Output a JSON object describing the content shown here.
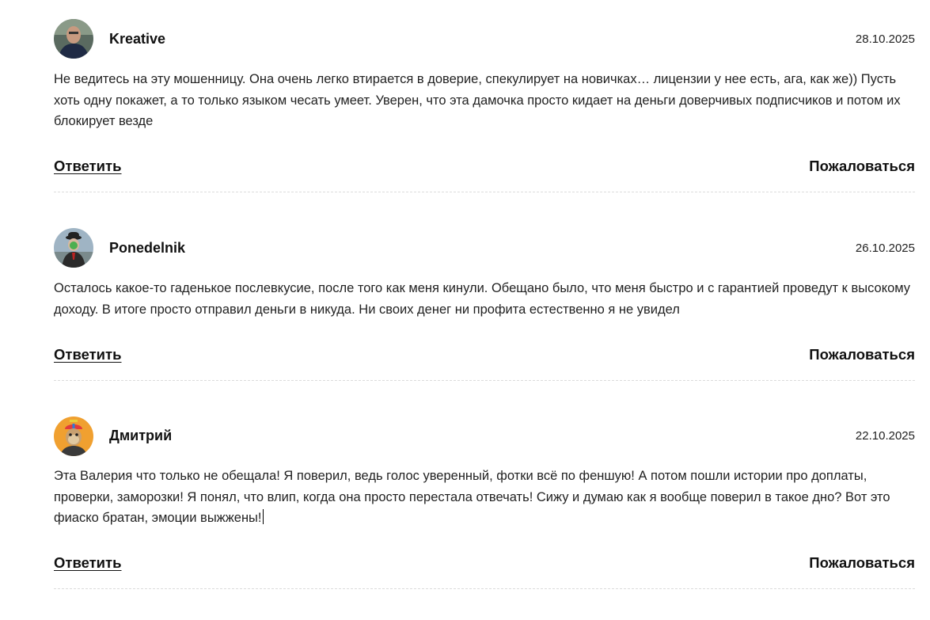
{
  "comments": [
    {
      "author": "Kreative",
      "date": "28.10.2025",
      "avatar_icon": "user-photo-avatar",
      "text": "Не ведитесь на эту мошенницу. Она очень легко втирается в доверие, спекулирует на новичках… лицензии у нее есть, ага, как же)) Пусть хоть одну покажет, а то только языком чесать умеет. Уверен, что эта дамочка просто кидает на деньги доверчивых подписчиков и потом их блокирует везде",
      "reply_label": "Ответить",
      "report_label": "Пожаловаться"
    },
    {
      "author": "Ponedelnik",
      "date": "26.10.2025",
      "avatar_icon": "man-in-bowler-hat-avatar",
      "text": "Осталось какое-то гаденькое послевкусие, после того как меня кинули. Обещано было, что меня быстро и с гарантией проведут к высокому доходу. В итоге просто отправил деньги в никуда. Ни своих денег ни профита естественно я не увидел",
      "reply_label": "Ответить",
      "report_label": "Пожаловаться"
    },
    {
      "author": "Дмитрий",
      "date": "22.10.2025",
      "avatar_icon": "ape-with-propeller-cap-avatar",
      "text": "Эта Валерия что только не обещала! Я поверил, ведь голос уверенный, фотки всё по феншую! А потом пошли истории про доплаты, проверки, заморозки! Я понял, что влип, когда она просто перестала отвечать! Сижу и думаю как я вообще поверил в такое дно? Вот это фиаско братан, эмоции выжжены!",
      "reply_label": "Ответить",
      "report_label": "Пожаловаться"
    }
  ],
  "colors": {
    "text": "#222222",
    "divider": "#dcdcdc",
    "avatar3_bg": "#f0a030"
  }
}
